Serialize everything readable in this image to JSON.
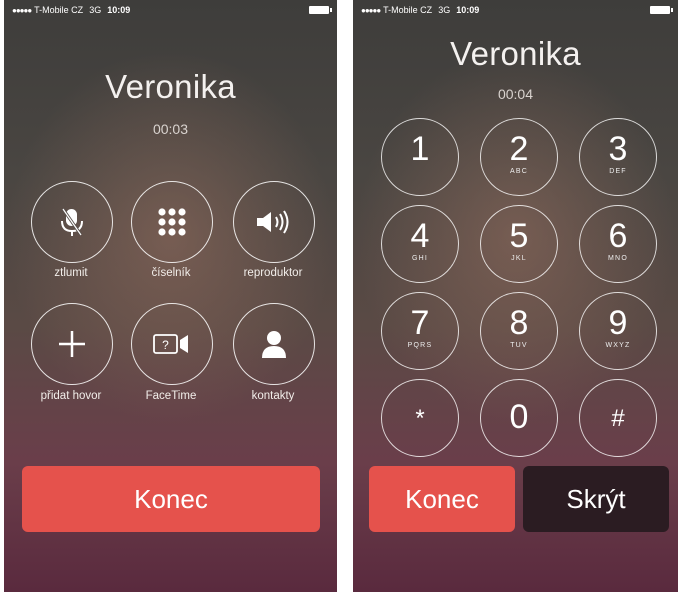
{
  "left": {
    "status": {
      "signal": "●●●●●",
      "carrier": "T-Mobile CZ",
      "network": "3G",
      "time": "10:09"
    },
    "caller_name": "Veronika",
    "call_timer": "00:03",
    "controls": [
      {
        "label": "ztlumit",
        "icon": "microphone-muted-icon"
      },
      {
        "label": "číselník",
        "icon": "keypad-icon"
      },
      {
        "label": "reproduktor",
        "icon": "speaker-icon"
      },
      {
        "label": "přidat hovor",
        "icon": "plus-icon"
      },
      {
        "label": "FaceTime",
        "icon": "facetime-icon"
      },
      {
        "label": "kontakty",
        "icon": "contact-icon"
      }
    ],
    "end_label": "Konec"
  },
  "right": {
    "status": {
      "signal": "●●●●●",
      "carrier": "T-Mobile CZ",
      "network": "3G",
      "time": "10:09"
    },
    "caller_name": "Veronika",
    "call_timer": "00:04",
    "keypad": [
      {
        "digit": "1",
        "letters": ""
      },
      {
        "digit": "2",
        "letters": "ABC"
      },
      {
        "digit": "3",
        "letters": "DEF"
      },
      {
        "digit": "4",
        "letters": "GHI"
      },
      {
        "digit": "5",
        "letters": "JKL"
      },
      {
        "digit": "6",
        "letters": "MNO"
      },
      {
        "digit": "7",
        "letters": "PQRS"
      },
      {
        "digit": "8",
        "letters": "TUV"
      },
      {
        "digit": "9",
        "letters": "WXYZ"
      },
      {
        "digit": "*",
        "letters": ""
      },
      {
        "digit": "0",
        "letters": ""
      },
      {
        "digit": "#",
        "letters": ""
      }
    ],
    "end_label": "Konec",
    "hide_label": "Skrýt"
  },
  "colors": {
    "end_button": "#e5524c",
    "hide_button": "#2b1c22"
  }
}
